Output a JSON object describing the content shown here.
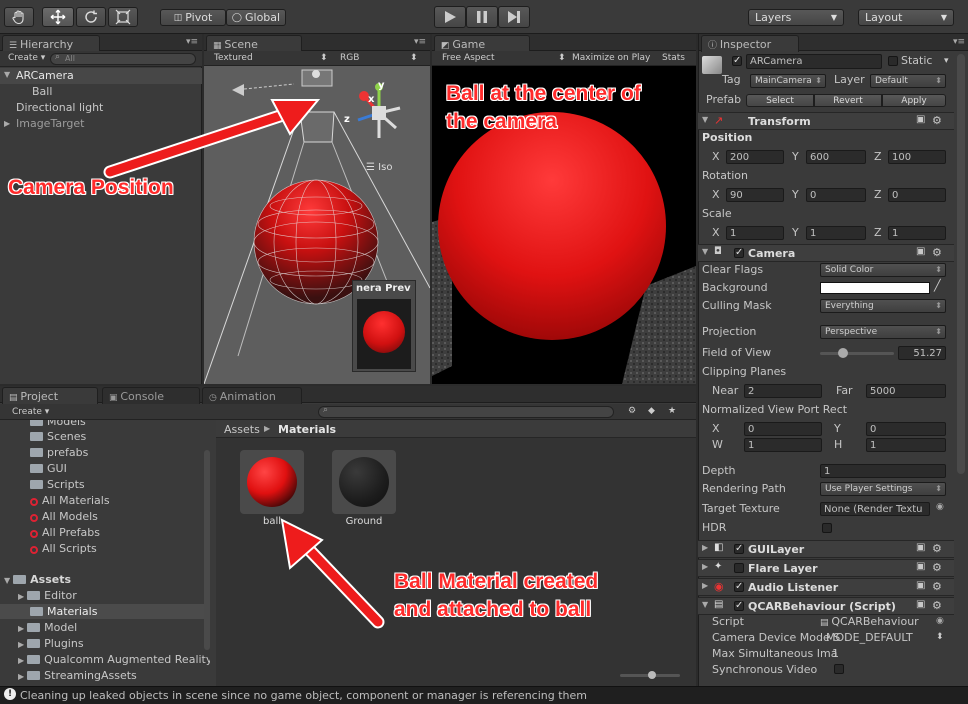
{
  "toolbar": {
    "tools": [
      "hand-tool",
      "move-tool",
      "rotate-tool",
      "scale-tool"
    ],
    "pivot": "Pivot",
    "global": "Global",
    "layers": "Layers",
    "layout": "Layout"
  },
  "hierarchy": {
    "tab": "Hierarchy",
    "create": "Create",
    "search_placeholder": "All",
    "items": [
      "ARCamera",
      "Ball",
      "Directional light",
      "ImageTarget"
    ]
  },
  "scene": {
    "tab": "Scene",
    "shading": "Textured",
    "render_mode": "RGB",
    "gizmo_axes": {
      "x": "x",
      "y": "y",
      "z": "z"
    },
    "iso": "Iso",
    "camera_preview": "nera Prev"
  },
  "game": {
    "tab": "Game",
    "aspect": "Free Aspect",
    "maximize": "Maximize on Play",
    "stats": "Stats"
  },
  "project": {
    "tabs": [
      "Project",
      "Console",
      "Animation"
    ],
    "create": "Create",
    "favorites": [
      {
        "label": "Models",
        "kind": "folder"
      },
      {
        "label": "Scenes",
        "kind": "folder"
      },
      {
        "label": "prefabs",
        "kind": "folder"
      },
      {
        "label": "GUI",
        "kind": "folder"
      },
      {
        "label": "Scripts",
        "kind": "folder"
      },
      {
        "label": "All Materials",
        "kind": "search"
      },
      {
        "label": "All Models",
        "kind": "search"
      },
      {
        "label": "All Prefabs",
        "kind": "search"
      },
      {
        "label": "All Scripts",
        "kind": "search"
      }
    ],
    "assets_root": "Assets",
    "assets": [
      "Editor",
      "Materials",
      "Model",
      "Plugins",
      "Qualcomm Augmented Reality",
      "StreamingAssets"
    ],
    "breadcrumb": {
      "root": "Assets",
      "current": "Materials"
    },
    "materials": [
      "ball",
      "Ground"
    ]
  },
  "inspector": {
    "tab": "Inspector",
    "object_name": "ARCamera",
    "static": "Static",
    "tag_label": "Tag",
    "tag": "MainCamera",
    "layer_label": "Layer",
    "layer": "Default",
    "prefab_label": "Prefab",
    "prefab_buttons": [
      "Select",
      "Revert",
      "Apply"
    ],
    "transform": {
      "title": "Transform",
      "position_label": "Position",
      "position": {
        "x": "200",
        "y": "600",
        "z": "100"
      },
      "rotation_label": "Rotation",
      "rotation": {
        "x": "90",
        "y": "0",
        "z": "0"
      },
      "scale_label": "Scale",
      "scale": {
        "x": "1",
        "y": "1",
        "z": "1"
      }
    },
    "camera": {
      "title": "Camera",
      "clear_flags_label": "Clear Flags",
      "clear_flags": "Solid Color",
      "background_label": "Background",
      "culling_mask_label": "Culling Mask",
      "culling_mask": "Everything",
      "projection_label": "Projection",
      "projection": "Perspective",
      "fov_label": "Field of View",
      "fov": "51.27",
      "fov_fraction": 0.28,
      "clipping_label": "Clipping Planes",
      "near_label": "Near",
      "near": "2",
      "far_label": "Far",
      "far": "5000",
      "viewport_label": "Normalized View Port Rect",
      "vp": {
        "x_label": "X",
        "x": "0",
        "y_label": "Y",
        "y": "0",
        "w_label": "W",
        "w": "1",
        "h_label": "H",
        "h": "1"
      },
      "depth_label": "Depth",
      "depth": "1",
      "rendering_path_label": "Rendering Path",
      "rendering_path": "Use Player Settings",
      "target_texture_label": "Target Texture",
      "target_texture": "None (Render Textu",
      "hdr_label": "HDR"
    },
    "components": [
      "GUILayer",
      "Flare Layer",
      "Audio Listener",
      "QCARBehaviour (Script)"
    ],
    "qcar": {
      "script_label": "Script",
      "script": "QCARBehaviour",
      "device_mode_label": "Camera Device Mode S",
      "device_mode": "MODE_DEFAULT",
      "max_sim_label": "Max Simultaneous Ima",
      "max_sim": "1",
      "sync_label": "Synchronous Video"
    }
  },
  "annotations": {
    "camera_position": "Camera Position",
    "ball_center_1": "Ball at the center of",
    "ball_center_2": "the camera",
    "material_1": "Ball Material created",
    "material_2": "and attached to ball"
  },
  "status": "Cleaning up leaked objects in scene since no game object, component or manager is referencing them",
  "colors": {
    "accent": "#ff2b2b",
    "ball": "#e31515",
    "panel": "#3a3a3a",
    "background": "#2b2b2b"
  }
}
